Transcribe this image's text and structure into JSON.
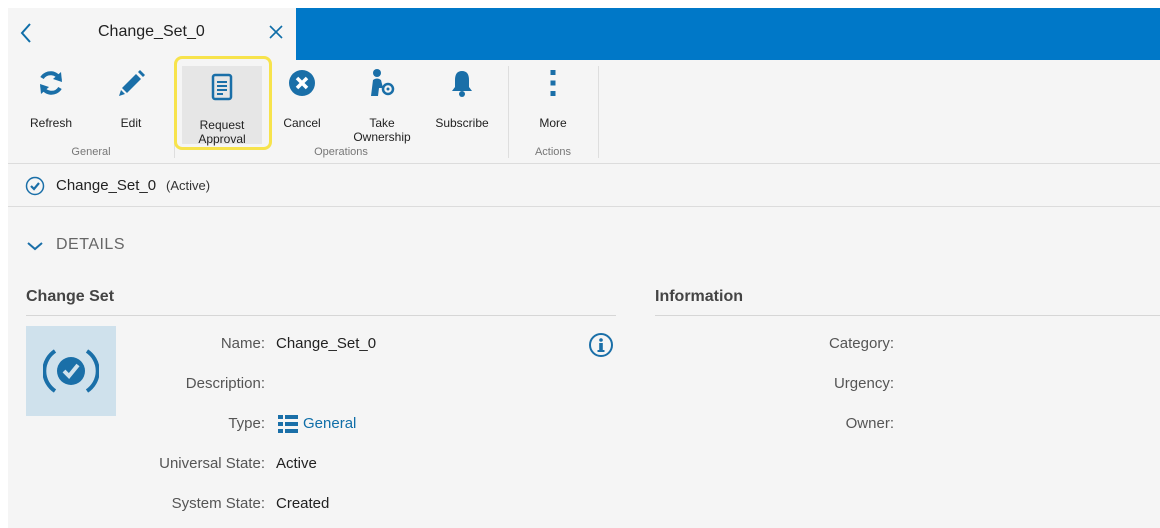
{
  "tab": {
    "title": "Change_Set_0"
  },
  "ribbon": {
    "groups": {
      "general": "General",
      "operations": "Operations",
      "actions": "Actions"
    },
    "buttons": {
      "refresh": "Refresh",
      "edit": "Edit",
      "request_approval_line1": "Request",
      "request_approval_line2": "Approval",
      "cancel": "Cancel",
      "take_ownership_line1": "Take",
      "take_ownership_line2": "Ownership",
      "subscribe": "Subscribe",
      "more": "More"
    }
  },
  "breadcrumb": {
    "name": "Change_Set_0",
    "state": "(Active)"
  },
  "details": {
    "header": "DETAILS",
    "change_set": {
      "title": "Change Set",
      "fields": {
        "name_label": "Name:",
        "name_value": "Change_Set_0",
        "description_label": "Description:",
        "description_value": "",
        "type_label": "Type:",
        "type_value": "General",
        "universal_state_label": "Universal State:",
        "universal_state_value": "Active",
        "system_state_label": "System State:",
        "system_state_value": "Created"
      }
    },
    "information": {
      "title": "Information",
      "fields": {
        "category_label": "Category:",
        "urgency_label": "Urgency:",
        "owner_label": "Owner:"
      }
    }
  },
  "colors": {
    "accent": "#0078c8",
    "icon_blue": "#1a6fa8",
    "highlight": "#f7e34c",
    "avatar_bg": "#cfe1ec"
  }
}
